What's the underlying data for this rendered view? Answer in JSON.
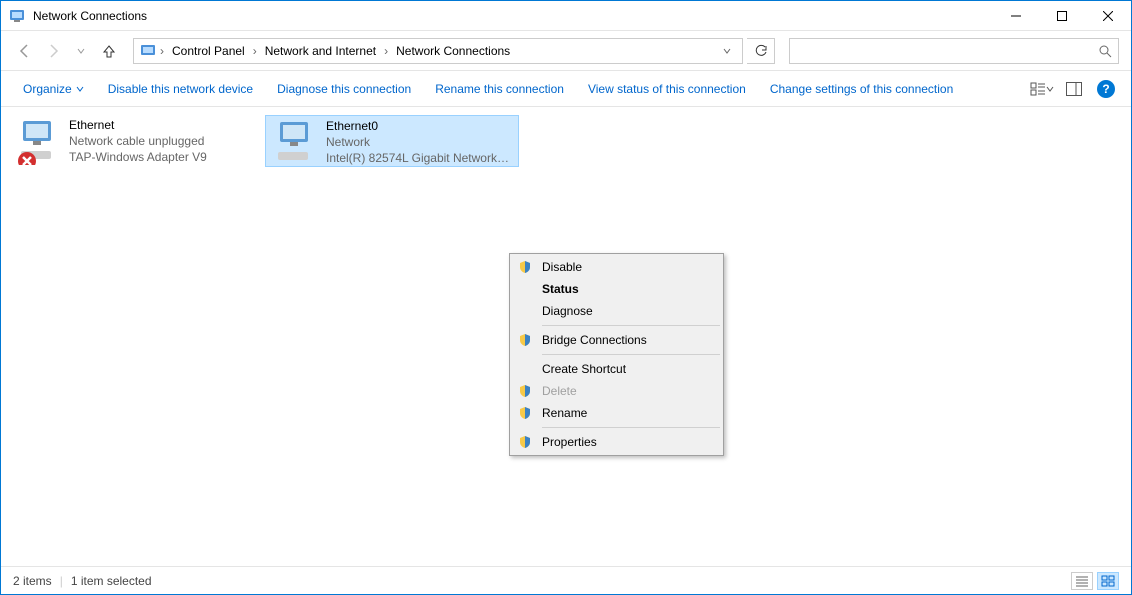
{
  "window": {
    "title": "Network Connections"
  },
  "breadcrumb": {
    "0": "Control Panel",
    "1": "Network and Internet",
    "2": "Network Connections"
  },
  "search": {
    "placeholder": ""
  },
  "toolbar": {
    "organize": "Organize",
    "disable": "Disable this network device",
    "diagnose": "Diagnose this connection",
    "rename": "Rename this connection",
    "viewstatus": "View status of this connection",
    "changesettings": "Change settings of this connection"
  },
  "connections": {
    "0": {
      "name": "Ethernet",
      "status": "Network cable unplugged",
      "device": "TAP-Windows Adapter V9"
    },
    "1": {
      "name": "Ethernet0",
      "status": "Network",
      "device": "Intel(R) 82574L Gigabit Network C..."
    }
  },
  "context_menu": {
    "disable": "Disable",
    "status": "Status",
    "diagnose": "Diagnose",
    "bridge": "Bridge Connections",
    "shortcut": "Create Shortcut",
    "delete": "Delete",
    "rename": "Rename",
    "properties": "Properties"
  },
  "statusbar": {
    "count": "2 items",
    "selected": "1 item selected"
  }
}
